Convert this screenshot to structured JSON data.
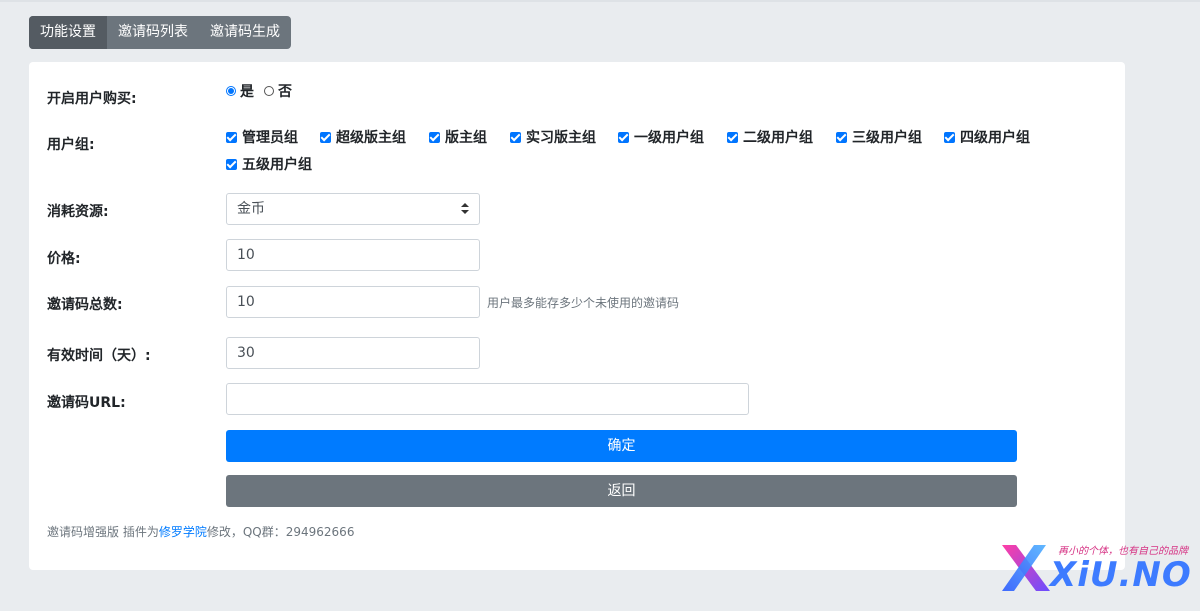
{
  "tabs": [
    {
      "label": "功能设置"
    },
    {
      "label": "邀请码列表"
    },
    {
      "label": "邀请码生成"
    }
  ],
  "form": {
    "enable_purchase": {
      "label": "开启用户购买:",
      "options": [
        {
          "label": "是",
          "checked": true
        },
        {
          "label": "否",
          "checked": false
        }
      ]
    },
    "user_groups": {
      "label": "用户组:",
      "items": [
        {
          "label": "管理员组",
          "checked": true
        },
        {
          "label": "超级版主组",
          "checked": true
        },
        {
          "label": "版主组",
          "checked": true
        },
        {
          "label": "实习版主组",
          "checked": true
        },
        {
          "label": "一级用户组",
          "checked": true
        },
        {
          "label": "二级用户组",
          "checked": true
        },
        {
          "label": "三级用户组",
          "checked": true
        },
        {
          "label": "四级用户组",
          "checked": true
        },
        {
          "label": "五级用户组",
          "checked": true
        }
      ]
    },
    "resource": {
      "label": "消耗资源:",
      "value": "金币"
    },
    "price": {
      "label": "价格:",
      "value": "10"
    },
    "total": {
      "label": "邀请码总数:",
      "value": "10",
      "help": "用户最多能存多少个未使用的邀请码"
    },
    "valid_days": {
      "label": "有效时间（天）:",
      "value": "30"
    },
    "url": {
      "label": "邀请码URL:",
      "value": ""
    },
    "confirm_label": "确定",
    "back_label": "返回"
  },
  "footer": {
    "prefix": "邀请码增强版 插件为",
    "link": "修罗学院",
    "suffix": "修改，QQ群：294962666"
  },
  "watermark": {
    "slogan": "再小的个体，也有自己的品牌",
    "brand": "XiU.NO"
  },
  "colors": {
    "primary": "#007bff",
    "secondary": "#6c757d",
    "checkbox": "#0075ff",
    "background": "#e9ecef"
  }
}
